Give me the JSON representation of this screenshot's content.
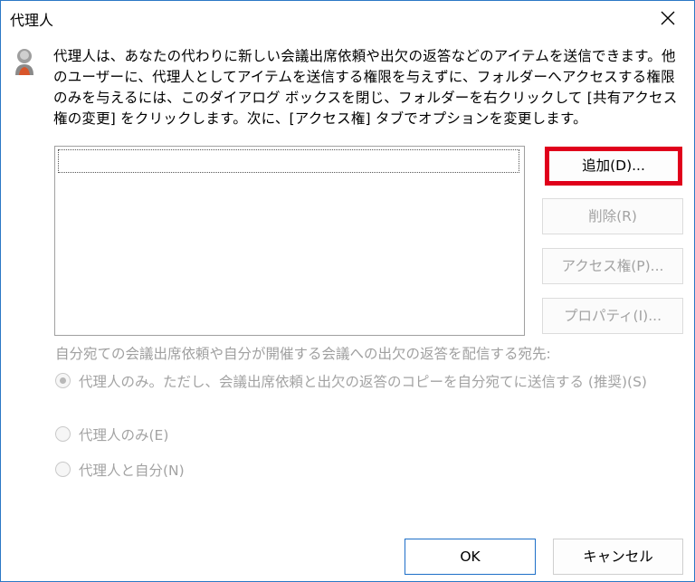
{
  "window": {
    "title": "代理人"
  },
  "description": "代理人は、あなたの代わりに新しい会議出席依頼や出欠の返答などのアイテムを送信できます。他のユーザーに、代理人としてアイテムを送信する権限を与えずに、フォルダーへアクセスする権限のみを与えるには、このダイアログ ボックスを閉じ、フォルダーを右クリックして [共有アクセス権の変更] をクリックします。次に、[アクセス権] タブでオプションを変更します。",
  "buttons": {
    "add": "追加(D)...",
    "remove": "削除(R)",
    "access": "アクセス権(P)...",
    "properties": "プロパティ(I)...",
    "ok": "OK",
    "cancel": "キャンセル"
  },
  "delivery": {
    "label": "自分宛ての会議出席依頼や自分が開催する会議への出欠の返答を配信する宛先:",
    "options": [
      {
        "label": "代理人のみ。ただし、会議出席依頼と出欠の返答のコピーを自分宛てに送信する (推奨)(S)",
        "checked": true
      },
      {
        "label": "代理人のみ(E)",
        "checked": false
      },
      {
        "label": "代理人と自分(N)",
        "checked": false
      }
    ]
  },
  "colors": {
    "highlight": "#e0001b",
    "focus_border": "#1e6fc8",
    "disabled_text": "#a3a3a3"
  },
  "icons": [
    "user-icon",
    "close-icon"
  ]
}
